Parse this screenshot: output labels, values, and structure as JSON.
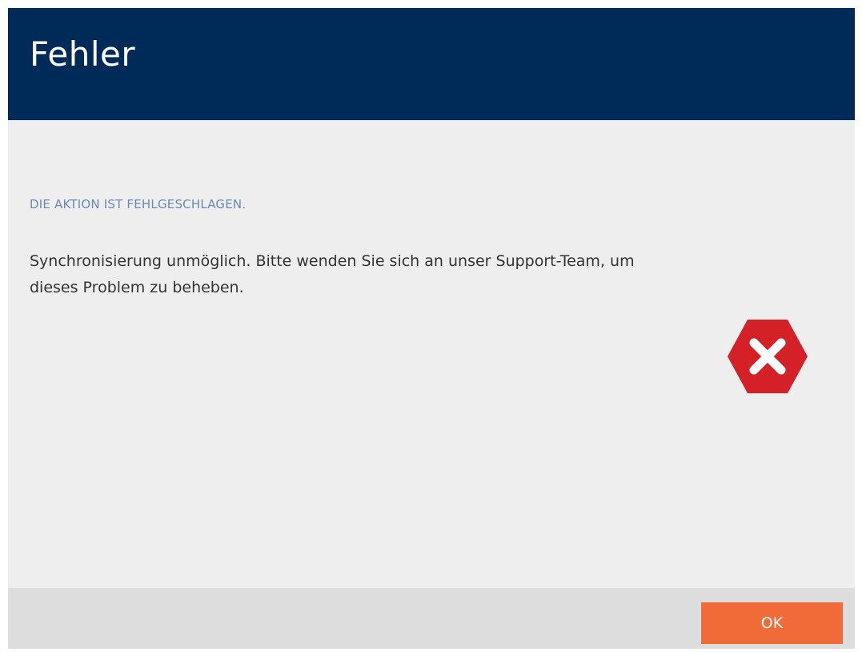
{
  "dialog": {
    "title": "Fehler",
    "subheading": "DIE AKTION IST FEHLGESCHLAGEN.",
    "message": "Synchronisierung unmöglich. Bitte wenden Sie sich an unser Support-Team, um dieses Problem zu beheben.",
    "icon": "error-icon",
    "icon_color": "#d42027",
    "header_color": "#002b59",
    "accent_color": "#f06b38"
  },
  "footer": {
    "ok_label": "OK"
  }
}
